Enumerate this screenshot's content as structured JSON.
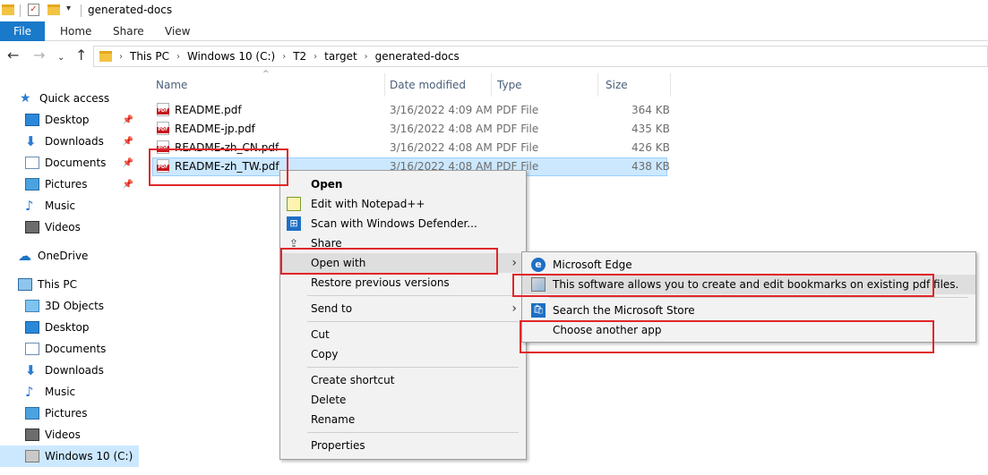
{
  "window": {
    "title": "generated-docs"
  },
  "ribbon": {
    "tabs": [
      "File",
      "Home",
      "Share",
      "View"
    ]
  },
  "address": {
    "crumbs": [
      "This PC",
      "Windows 10 (C:)",
      "T2",
      "target",
      "generated-docs"
    ]
  },
  "sidebar": {
    "items": [
      {
        "label": "Quick access",
        "icon": "star-icon"
      },
      {
        "label": "Desktop",
        "icon": "desktop-icon",
        "pinned": true
      },
      {
        "label": "Downloads",
        "icon": "downloads-icon",
        "pinned": true
      },
      {
        "label": "Documents",
        "icon": "documents-icon",
        "pinned": true
      },
      {
        "label": "Pictures",
        "icon": "pictures-icon",
        "pinned": true
      },
      {
        "label": "Music",
        "icon": "music-icon"
      },
      {
        "label": "Videos",
        "icon": "videos-icon"
      },
      {
        "label": "OneDrive",
        "icon": "onedrive-icon"
      },
      {
        "label": "This PC",
        "icon": "this-pc-icon"
      },
      {
        "label": "3D Objects",
        "icon": "3d-objects-icon"
      },
      {
        "label": "Desktop",
        "icon": "desktop-icon"
      },
      {
        "label": "Documents",
        "icon": "documents-icon"
      },
      {
        "label": "Downloads",
        "icon": "downloads-icon"
      },
      {
        "label": "Music",
        "icon": "music-icon"
      },
      {
        "label": "Pictures",
        "icon": "pictures-icon"
      },
      {
        "label": "Videos",
        "icon": "videos-icon"
      },
      {
        "label": "Windows 10 (C:)",
        "icon": "drive-icon",
        "selected": true
      }
    ]
  },
  "columns": {
    "name": "Name",
    "date": "Date modified",
    "type": "Type",
    "size": "Size"
  },
  "files": [
    {
      "name": "README.pdf",
      "date": "3/16/2022 4:09 AM",
      "type": "PDF File",
      "size": "364 KB"
    },
    {
      "name": "README-jp.pdf",
      "date": "3/16/2022 4:08 AM",
      "type": "PDF File",
      "size": "435 KB"
    },
    {
      "name": "README-zh_CN.pdf",
      "date": "3/16/2022 4:08 AM",
      "type": "PDF File",
      "size": "426 KB"
    },
    {
      "name": "README-zh_TW.pdf",
      "date": "3/16/2022 4:08 AM",
      "type": "PDF File",
      "size": "438 KB",
      "selected": true
    }
  ],
  "context_menu": {
    "open": "Open",
    "edit_notepad": "Edit with Notepad++",
    "scan_defender": "Scan with Windows Defender...",
    "share": "Share",
    "open_with": "Open with",
    "restore": "Restore previous versions",
    "send_to": "Send to",
    "cut": "Cut",
    "copy": "Copy",
    "create_shortcut": "Create shortcut",
    "delete": "Delete",
    "rename": "Rename",
    "properties": "Properties"
  },
  "open_with_menu": {
    "edge": "Microsoft Edge",
    "bookmark_app": "This software allows you to create and edit bookmarks on existing pdf files.",
    "store": "Search the Microsoft Store",
    "choose": "Choose another app"
  },
  "colors": {
    "accent": "#1979ca",
    "selection": "#cce8ff",
    "annotation": "#e0262a"
  }
}
